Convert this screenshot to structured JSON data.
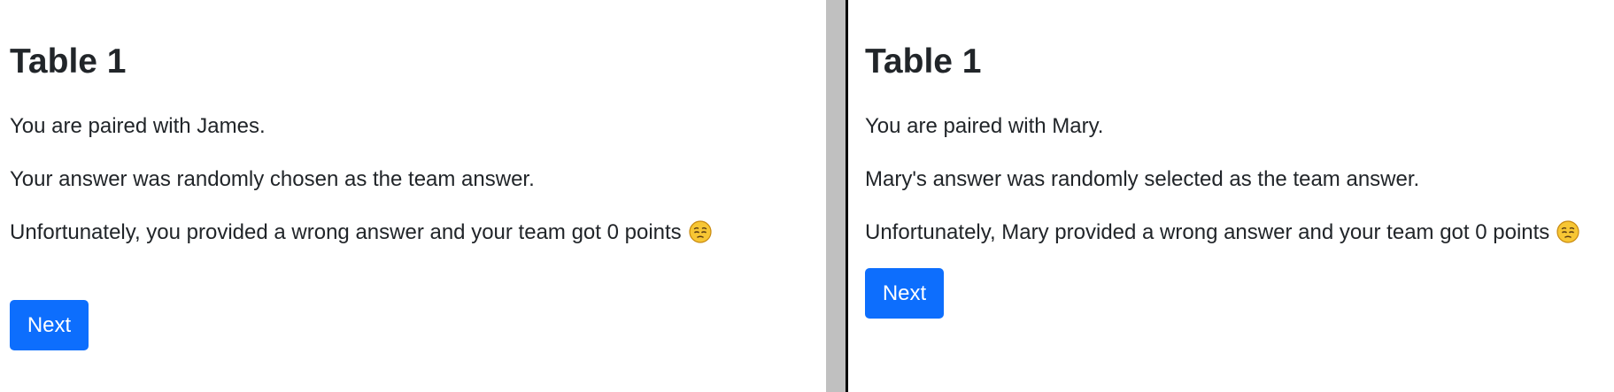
{
  "left_panel": {
    "title": "Table 1",
    "pairing": "You are paired with James.",
    "selection": "Your answer was randomly chosen as the team answer.",
    "result": "Unfortunately, you provided a wrong answer and your team got 0 points",
    "result_emoji": "pensive-face-icon",
    "next_label": "Next"
  },
  "right_panel": {
    "title": "Table 1",
    "pairing": "You are paired with Mary.",
    "selection": "Mary's answer was randomly selected as the team answer.",
    "result": "Unfortunately, Mary provided a wrong answer and your team got 0 points",
    "result_emoji": "pensive-face-icon",
    "next_label": "Next"
  },
  "colors": {
    "button": "#0d6efd",
    "text": "#212529",
    "divider_grey": "#c0c0c0",
    "divider_black": "#000000",
    "emoji_face": "#f7c634"
  }
}
